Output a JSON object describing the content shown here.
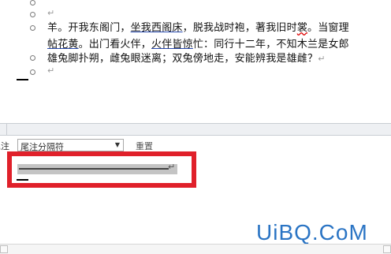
{
  "document": {
    "line1_pre": "羊。开我东阁门，",
    "line1_u1": "坐我",
    "line1_u2": "西阁床",
    "line1_mid": "，脱我战时袍，著我旧时",
    "line1_squig": "裳",
    "line1_end": "。当窗理",
    "line2_u1": "帖花黄",
    "line2_mid": "。出门看火伴，",
    "line2_u2": "火伴皆惊",
    "line2_end": "忙：同行十二年，不知木兰是女郎",
    "line3": "雄兔脚扑朔，雌兔眼迷离；双兔傍地走，安能辨我是雄雌？",
    "para_mark": "↵"
  },
  "footnote_pane": {
    "label_partial": "尾注",
    "select_value": "尾注分隔符",
    "reset_label": "重置",
    "para_mark": "↵"
  },
  "watermark": {
    "text": "UiBQ.CoM"
  },
  "colors": {
    "highlight_red": "#e0202a",
    "watermark_blue": "#2a74c4"
  }
}
